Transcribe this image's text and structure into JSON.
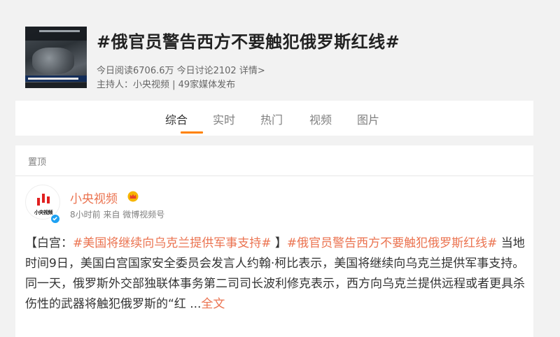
{
  "topic": {
    "title": "#俄官员警告西方不要触犯俄罗斯红线#",
    "stats": "今日阅读6706.6万 今日讨论2102",
    "detail_link": "详情>",
    "host": "主持人：小央视频 | 49家媒体发布"
  },
  "tabs": [
    {
      "label": "综合",
      "active": true
    },
    {
      "label": "实时",
      "active": false
    },
    {
      "label": "热门",
      "active": false
    },
    {
      "label": "视频",
      "active": false
    },
    {
      "label": "图片",
      "active": false
    }
  ],
  "colors": {
    "accent": "#ff8200",
    "link": "#eb7350",
    "verified": "#1da1f2"
  },
  "feed": {
    "pinned_label": "置顶",
    "post": {
      "avatar_text": "小央视频",
      "author": "小央视频",
      "meta": "8小时前 来自 微博视频号",
      "body_open": "【白宫：",
      "topic1": "#美国将继续向乌克兰提供军事支持#",
      "body_mid": " 】",
      "topic2": "#俄官员警告西方不要触犯俄罗斯红线#",
      "body_text": " 当地时间9日，美国白宫国家安全委员会发言人约翰·柯比表示，美国将继续向乌克兰提供军事支持。 同一天，俄罗斯外交部独联体事务第二司司长波利修克表示，西方向乌克兰提供远程或者更具杀伤性的武器将触犯俄罗斯的“红 ...",
      "expand": "全文"
    }
  }
}
